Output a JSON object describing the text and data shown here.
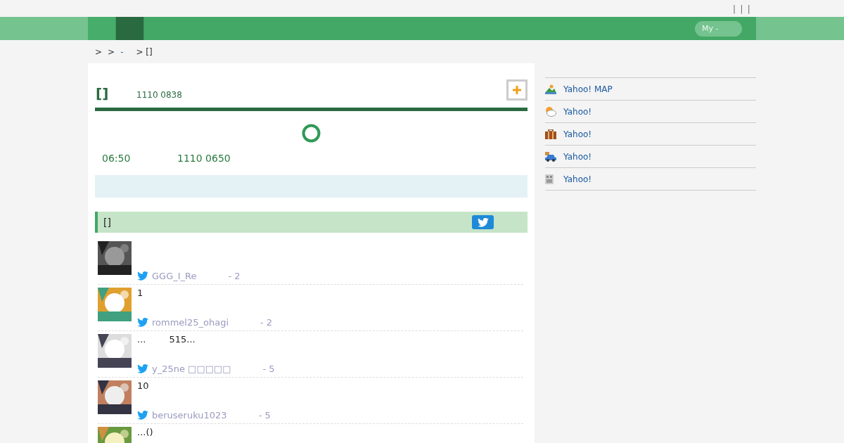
{
  "top_links": [
    "|",
    "|",
    "|"
  ],
  "nav": {
    "tabs": [
      {
        "selected": false
      },
      {
        "selected": true
      }
    ],
    "my_button": "My -"
  },
  "breadcrumb": [
    {
      "kind": "text",
      "text": ">"
    },
    {
      "kind": "text",
      "text": ">"
    },
    {
      "kind": "link",
      "text": "-"
    },
    {
      "kind": "text",
      "text": "> []"
    }
  ],
  "station": {
    "title": "[]",
    "subtitle": "1110 0838",
    "status": {
      "time": "06:50",
      "detail": "1110 0650"
    }
  },
  "tweets": {
    "title": "[]",
    "items": [
      {
        "user": "GGG_I_Re",
        "suffix": "- 2"
      },
      {
        "text": "1",
        "user": "rommel25_ohagi",
        "suffix": "- 2"
      },
      {
        "text": "...        515...",
        "user": "y_25ne □□□□□",
        "suffix": "- 5"
      },
      {
        "text": "10",
        "user": "beruseruku1023",
        "suffix": "- 5"
      },
      {
        "text": "...()"
      }
    ]
  },
  "sidebar": {
    "items": [
      {
        "kind": "map",
        "label": "Yahoo! MAP"
      },
      {
        "kind": "weather",
        "label": "Yahoo!"
      },
      {
        "kind": "travel",
        "label": "Yahoo!"
      },
      {
        "kind": "car",
        "label": "Yahoo!"
      },
      {
        "kind": "news",
        "label": "Yahoo!"
      }
    ]
  }
}
